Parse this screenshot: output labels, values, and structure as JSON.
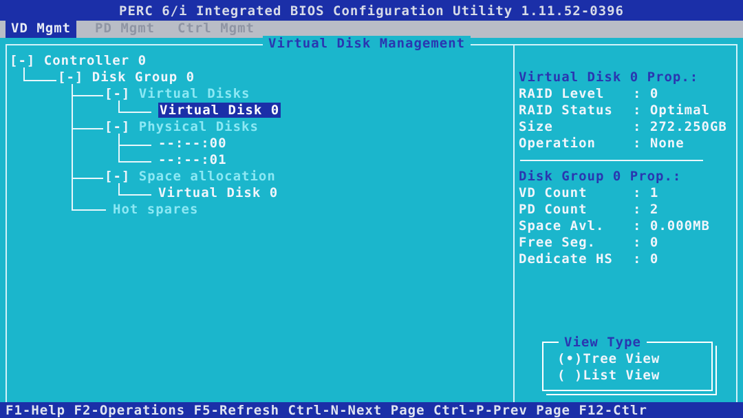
{
  "title": "PERC 6/i Integrated BIOS Configuration Utility 1.11.52-0396",
  "tabs": [
    {
      "label": "VD Mgmt"
    },
    {
      "label": "PD Mgmt"
    },
    {
      "label": "Ctrl Mgmt"
    }
  ],
  "panel_title": "Virtual Disk Management",
  "tree": {
    "controller": "[-] Controller 0",
    "disk_group": "[-] Disk Group 0",
    "vd_expander": "[-]",
    "vd_group": "Virtual Disks",
    "vd_item": "Virtual Disk 0",
    "pd_expander": "[-]",
    "pd_group": "Physical Disks",
    "pd_items": [
      "--:--:00",
      "--:--:01"
    ],
    "space_expander": "[-]",
    "space_group": "Space allocation",
    "space_item": "Virtual Disk 0",
    "hot_spares": "Hot spares"
  },
  "vd_props": {
    "heading": "Virtual Disk 0 Prop.:",
    "rows": [
      {
        "label": "RAID Level",
        "value": "0"
      },
      {
        "label": "RAID Status",
        "value": "Optimal"
      },
      {
        "label": "Size",
        "value": "272.250GB"
      },
      {
        "label": "Operation",
        "value": "None"
      }
    ]
  },
  "dg_props": {
    "heading": "Disk Group 0 Prop.:",
    "rows": [
      {
        "label": "VD Count",
        "value": "1"
      },
      {
        "label": "PD Count",
        "value": "2"
      },
      {
        "label": "Space Avl.",
        "value": "0.000MB"
      },
      {
        "label": "Free Seg.",
        "value": "0"
      },
      {
        "label": "Dedicate HS",
        "value": "0"
      }
    ]
  },
  "view_type": {
    "title": "View Type",
    "options": [
      {
        "marker": "(•)",
        "label": "Tree View"
      },
      {
        "marker": "( )",
        "label": "List View"
      }
    ]
  },
  "status_bar": "F1-Help F2-Operations F5-Refresh Ctrl-N-Next Page Ctrl-P-Prev Page F12-Ctlr",
  "colors": {
    "background": "#1bb6cc",
    "title_bar": "#1b2fa8",
    "selection": "#1b2fa8",
    "heading_text": "#2a36b0",
    "group_text": "#8ce8f4"
  }
}
